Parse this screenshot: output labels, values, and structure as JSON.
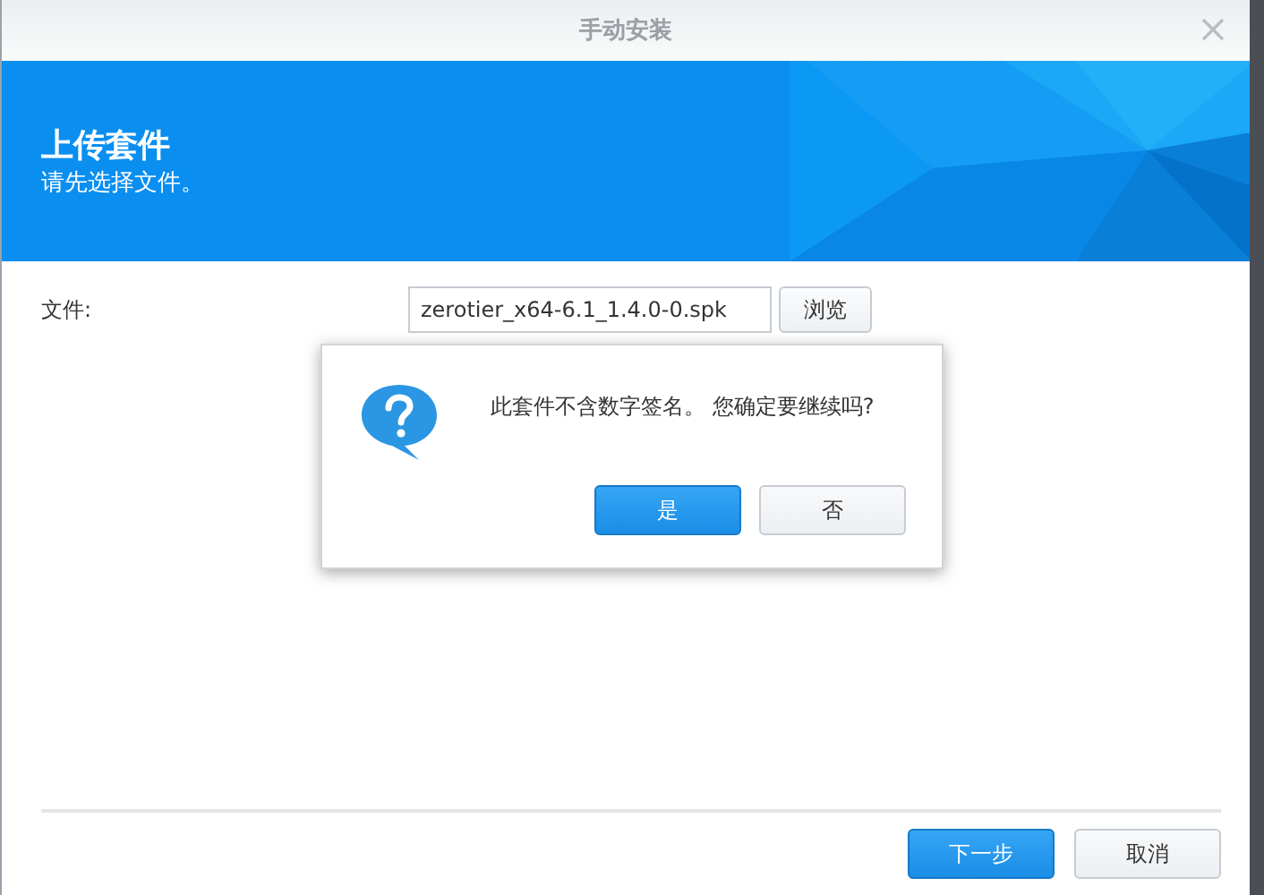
{
  "window": {
    "title": "手动安装"
  },
  "banner": {
    "title": "上传套件",
    "subtitle": "请先选择文件。"
  },
  "form": {
    "label": "文件:",
    "value": "zerotier_x64-6.1_1.4.0-0.spk",
    "browse": "浏览"
  },
  "dialog": {
    "message": "此套件不含数字签名。 您确定要继续吗?",
    "buttons": [
      {
        "label": "是",
        "kind": "primary"
      },
      {
        "label": "否",
        "kind": "default"
      }
    ]
  },
  "footer": {
    "buttons": [
      {
        "label": "下一步",
        "kind": "primary"
      },
      {
        "label": "取消",
        "kind": "default"
      }
    ]
  }
}
